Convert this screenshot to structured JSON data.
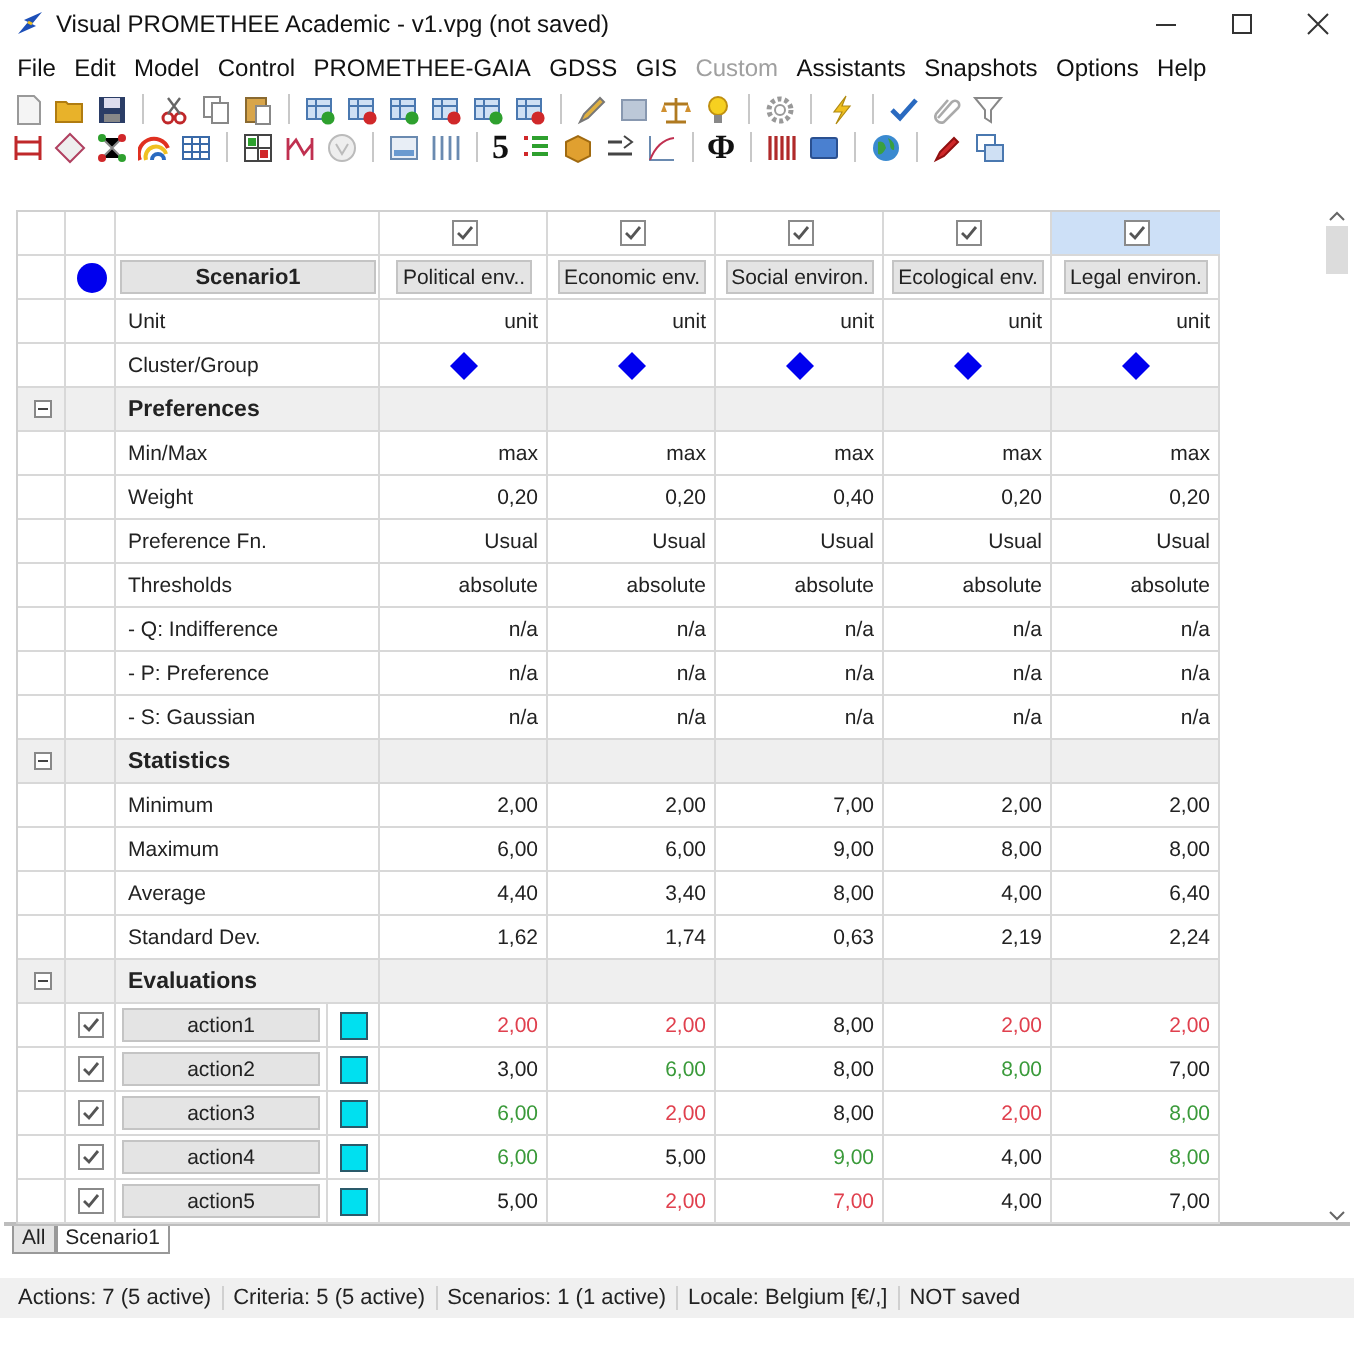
{
  "window": {
    "title": "Visual PROMETHEE Academic - v1.vpg (not saved)"
  },
  "menu": [
    {
      "label": "File",
      "disabled": false
    },
    {
      "label": "Edit",
      "disabled": false
    },
    {
      "label": "Model",
      "disabled": false
    },
    {
      "label": "Control",
      "disabled": false
    },
    {
      "label": "PROMETHEE-GAIA",
      "disabled": false
    },
    {
      "label": "GDSS",
      "disabled": false
    },
    {
      "label": "GIS",
      "disabled": false
    },
    {
      "label": "Custom",
      "disabled": true
    },
    {
      "label": "Assistants",
      "disabled": false
    },
    {
      "label": "Snapshots",
      "disabled": false
    },
    {
      "label": "Options",
      "disabled": false
    },
    {
      "label": "Help",
      "disabled": false
    }
  ],
  "toolbar": {
    "glyphs": [
      "5",
      "Φ"
    ]
  },
  "scenario": {
    "name": "Scenario1",
    "color": "#0000ee"
  },
  "criteria": [
    {
      "name": "Political env..",
      "active": true,
      "selected": false
    },
    {
      "name": "Economic env.",
      "active": true,
      "selected": false
    },
    {
      "name": "Social environ.",
      "active": true,
      "selected": false
    },
    {
      "name": "Ecological env.",
      "active": true,
      "selected": false
    },
    {
      "name": "Legal environ.",
      "active": true,
      "selected": true
    }
  ],
  "properties": [
    {
      "label": "Unit",
      "kind": "text",
      "values": [
        "unit",
        "unit",
        "unit",
        "unit",
        "unit"
      ]
    },
    {
      "label": "Cluster/Group",
      "kind": "cluster"
    }
  ],
  "sections": [
    {
      "label": "Preferences",
      "expanded": true,
      "rows": [
        {
          "label": "Min/Max",
          "values": [
            "max",
            "max",
            "max",
            "max",
            "max"
          ]
        },
        {
          "label": "Weight",
          "values": [
            "0,20",
            "0,20",
            "0,40",
            "0,20",
            "0,20"
          ]
        },
        {
          "label": "Preference Fn.",
          "values": [
            "Usual",
            "Usual",
            "Usual",
            "Usual",
            "Usual"
          ]
        },
        {
          "label": "Thresholds",
          "values": [
            "absolute",
            "absolute",
            "absolute",
            "absolute",
            "absolute"
          ]
        },
        {
          "label": "- Q: Indifference",
          "values": [
            "n/a",
            "n/a",
            "n/a",
            "n/a",
            "n/a"
          ]
        },
        {
          "label": "- P: Preference",
          "values": [
            "n/a",
            "n/a",
            "n/a",
            "n/a",
            "n/a"
          ]
        },
        {
          "label": "- S: Gaussian",
          "values": [
            "n/a",
            "n/a",
            "n/a",
            "n/a",
            "n/a"
          ]
        }
      ]
    },
    {
      "label": "Statistics",
      "expanded": true,
      "rows": [
        {
          "label": "Minimum",
          "values": [
            "2,00",
            "2,00",
            "7,00",
            "2,00",
            "2,00"
          ]
        },
        {
          "label": "Maximum",
          "values": [
            "6,00",
            "6,00",
            "9,00",
            "8,00",
            "8,00"
          ]
        },
        {
          "label": "Average",
          "values": [
            "4,40",
            "3,40",
            "8,00",
            "4,00",
            "6,40"
          ]
        },
        {
          "label": "Standard Dev.",
          "values": [
            "1,62",
            "1,74",
            "0,63",
            "2,19",
            "2,24"
          ]
        }
      ]
    },
    {
      "label": "Evaluations",
      "expanded": true,
      "actions": [
        {
          "name": "action1",
          "active": true,
          "color": "#00e0f0",
          "values": [
            {
              "text": "2,00",
              "kind": "worst"
            },
            {
              "text": "2,00",
              "kind": "worst"
            },
            {
              "text": "8,00",
              "kind": "plain"
            },
            {
              "text": "2,00",
              "kind": "worst"
            },
            {
              "text": "2,00",
              "kind": "worst"
            }
          ]
        },
        {
          "name": "action2",
          "active": true,
          "color": "#00e0f0",
          "values": [
            {
              "text": "3,00",
              "kind": "plain"
            },
            {
              "text": "6,00",
              "kind": "best"
            },
            {
              "text": "8,00",
              "kind": "plain"
            },
            {
              "text": "8,00",
              "kind": "best"
            },
            {
              "text": "7,00",
              "kind": "plain"
            }
          ]
        },
        {
          "name": "action3",
          "active": true,
          "color": "#00e0f0",
          "values": [
            {
              "text": "6,00",
              "kind": "best"
            },
            {
              "text": "2,00",
              "kind": "worst"
            },
            {
              "text": "8,00",
              "kind": "plain"
            },
            {
              "text": "2,00",
              "kind": "worst"
            },
            {
              "text": "8,00",
              "kind": "best"
            }
          ]
        },
        {
          "name": "action4",
          "active": true,
          "color": "#00e0f0",
          "values": [
            {
              "text": "6,00",
              "kind": "best"
            },
            {
              "text": "5,00",
              "kind": "plain"
            },
            {
              "text": "9,00",
              "kind": "best"
            },
            {
              "text": "4,00",
              "kind": "plain"
            },
            {
              "text": "8,00",
              "kind": "best"
            }
          ]
        },
        {
          "name": "action5",
          "active": true,
          "color": "#00e0f0",
          "values": [
            {
              "text": "5,00",
              "kind": "plain"
            },
            {
              "text": "2,00",
              "kind": "worst"
            },
            {
              "text": "7,00",
              "kind": "worst"
            },
            {
              "text": "4,00",
              "kind": "plain"
            },
            {
              "text": "7,00",
              "kind": "plain"
            }
          ]
        }
      ]
    }
  ],
  "tabs": [
    {
      "label": "All",
      "selected": false
    },
    {
      "label": "Scenario1",
      "selected": true
    }
  ],
  "status_bar": [
    "Actions: 7 (5 active)",
    "Criteria: 5 (5 active)",
    "Scenarios: 1 (1 active)",
    "Locale: Belgium [€/,]",
    "NOT saved"
  ]
}
